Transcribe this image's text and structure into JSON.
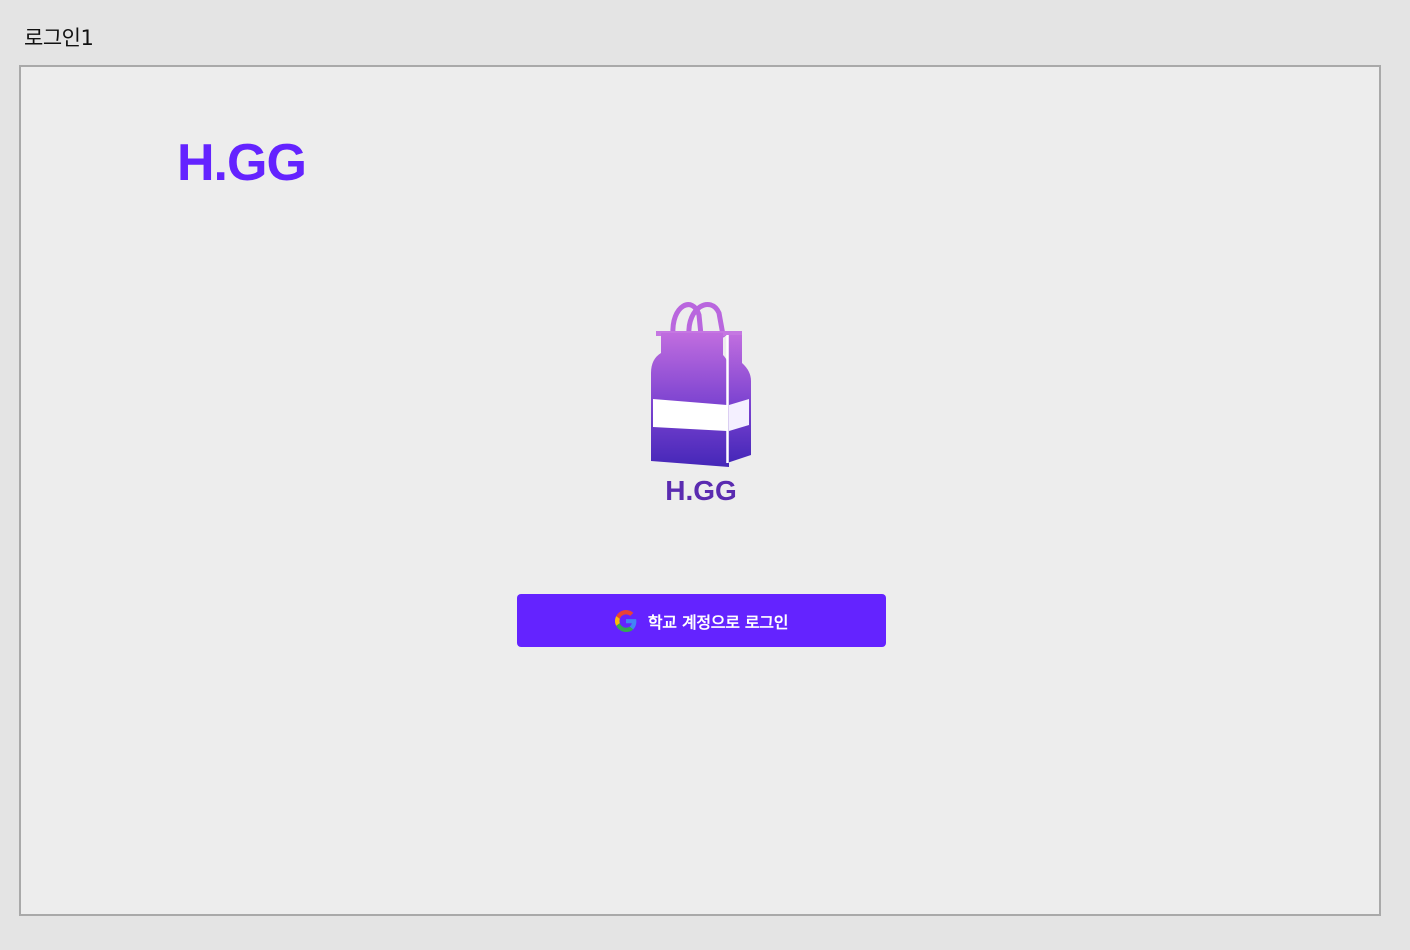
{
  "canvas": {
    "frame_label": "로그인1"
  },
  "header": {
    "brand_title": "H.GG"
  },
  "logo": {
    "icon": "shopping-bag-icon",
    "text": "H.GG"
  },
  "login": {
    "button_label": "학교 계정으로 로그인",
    "icon": "google-icon"
  },
  "colors": {
    "accent": "#6423ff",
    "background": "#ededed",
    "canvas": "#e4e4e4",
    "logo_gradient_top": "#b86ce0",
    "logo_gradient_bottom": "#4a2bc0"
  }
}
